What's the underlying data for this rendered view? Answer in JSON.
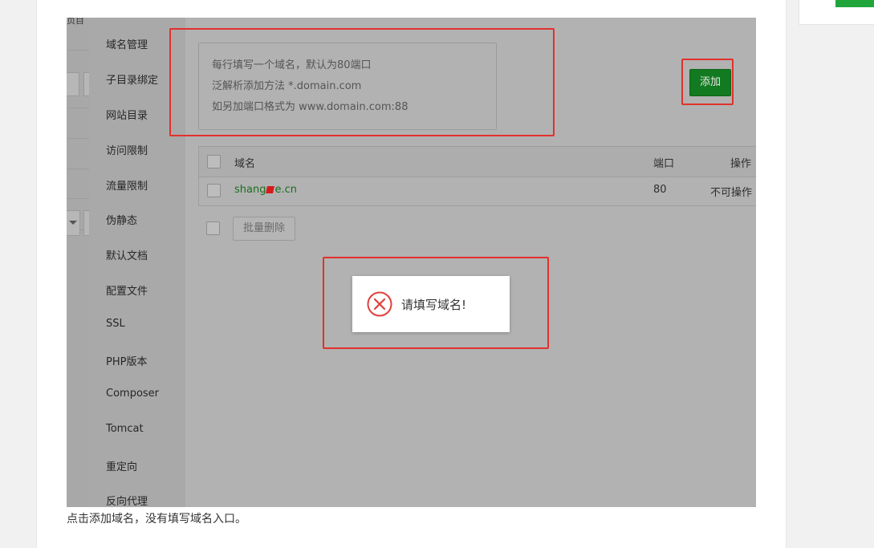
{
  "background_strip": {
    "top_text": "页目"
  },
  "menu": {
    "items": [
      "域名管理",
      "子目录绑定",
      "网站目录",
      "访问限制",
      "流量限制",
      "伪静态",
      "默认文档",
      "配置文件",
      "SSL",
      "PHP版本",
      "Composer",
      "Tomcat",
      "重定向",
      "反向代理"
    ]
  },
  "domain_input": {
    "placeholder_lines": [
      "每行填写一个域名，默认为80端口",
      "泛解析添加方法 *.domain.com",
      "如另加端口格式为 www.domain.com:88"
    ]
  },
  "add_button": {
    "label": "添加"
  },
  "table": {
    "headers": {
      "domain": "域名",
      "port": "端口",
      "action": "操作"
    },
    "rows": [
      {
        "domain_prefix": "shang",
        "domain_suffix": "e.cn",
        "port": "80",
        "action": "不可操作"
      }
    ]
  },
  "batch_delete_button": {
    "label": "批量删除"
  },
  "toast": {
    "message": "请填写域名!"
  },
  "caption": {
    "text": "点击添加域名，没有填写域名入口。"
  },
  "colors": {
    "accent_green": "#20a53a",
    "highlight_red": "#e1312c",
    "error_red": "#e0403c"
  }
}
